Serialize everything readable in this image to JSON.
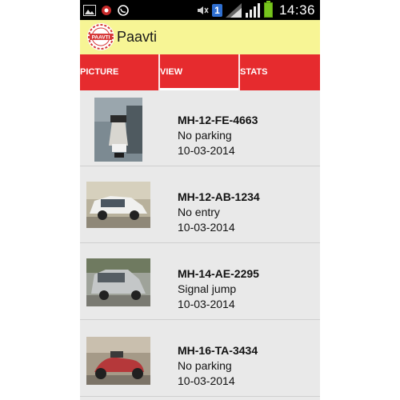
{
  "status_bar": {
    "time": "14:36",
    "notification_badge": "1",
    "icons": [
      "image-icon",
      "msg-icon",
      "whatsapp-icon",
      "mute-icon",
      "badge-icon",
      "wifi-icon",
      "signal-icon",
      "battery-icon"
    ]
  },
  "app": {
    "title": "Paavti",
    "logo_label": "PAAVTI"
  },
  "tabs": [
    {
      "label": "PICTURE",
      "active": false
    },
    {
      "label": "VIEW",
      "active": true
    },
    {
      "label": "STATS",
      "active": false
    }
  ],
  "records": [
    {
      "plate": "MH-12-FE-4663",
      "violation": "No parking",
      "date": "10-03-2014",
      "thumb": "scooter"
    },
    {
      "plate": "MH-12-AB-1234",
      "violation": "No entry",
      "date": "10-03-2014",
      "thumb": "white-car"
    },
    {
      "plate": "MH-14-AE-2295",
      "violation": "Signal jump",
      "date": "10-03-2014",
      "thumb": "silver-car"
    },
    {
      "plate": "MH-16-TA-3434",
      "violation": "No parking",
      "date": "10-03-2014",
      "thumb": "red-scooter"
    }
  ],
  "colors": {
    "status_bar": "#000000",
    "app_bar": "#f7f595",
    "tab_bar": "#e62b2e",
    "list_bg": "#e9e9e9"
  }
}
